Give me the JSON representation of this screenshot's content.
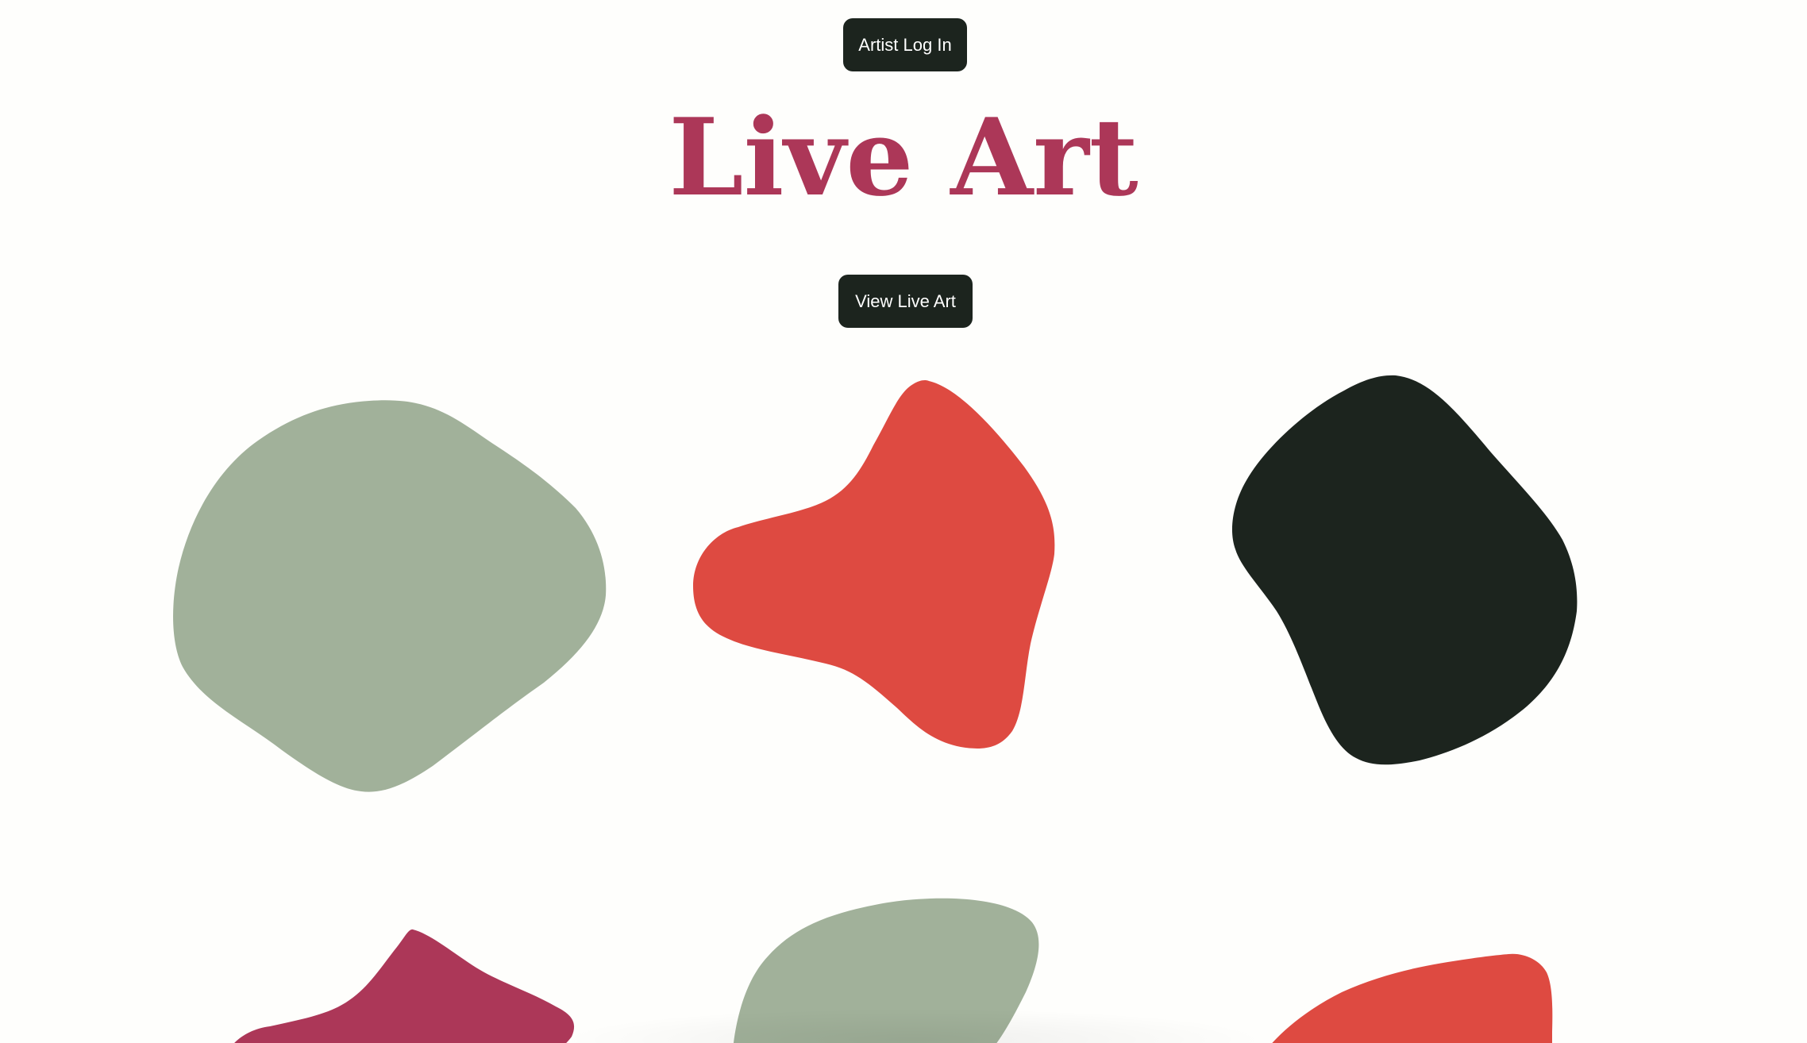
{
  "header": {
    "login_label": "Artist Log In",
    "title": "Live Art",
    "view_label": "View Live Art"
  },
  "colors": {
    "background": "#fefefc",
    "accent": "#ac3758",
    "button": "#1c241e",
    "sage": "#a1b19a",
    "red": "#de4a41",
    "dark": "#1c241e",
    "maroon": "#ac3758"
  },
  "artworks": [
    {
      "name": "blob-sage",
      "color": "sage"
    },
    {
      "name": "blob-red",
      "color": "red"
    },
    {
      "name": "blob-dark",
      "color": "dark"
    },
    {
      "name": "blob-maroon",
      "color": "maroon"
    },
    {
      "name": "blob-sage",
      "color": "sage"
    },
    {
      "name": "blob-red",
      "color": "red"
    }
  ]
}
